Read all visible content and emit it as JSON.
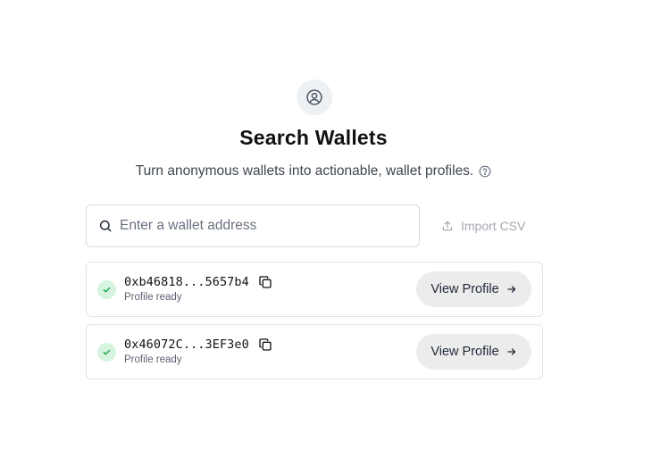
{
  "header": {
    "icon": "user-circle-icon",
    "title": "Search Wallets",
    "subtitle": "Turn anonymous wallets into actionable, wallet profiles.",
    "help_icon": "help-circle-icon"
  },
  "search": {
    "placeholder": "Enter a wallet address",
    "value": "",
    "icon": "search-icon"
  },
  "import": {
    "label": "Import CSV",
    "icon": "upload-icon",
    "enabled": false
  },
  "wallets": [
    {
      "address": "0xb46818...5657b4",
      "status": "Profile ready",
      "action_label": "View Profile"
    },
    {
      "address": "0x46072C...3EF3e0",
      "status": "Profile ready",
      "action_label": "View Profile"
    }
  ],
  "colors": {
    "status_ready_bg": "#d6f5e1",
    "status_ready_fg": "#16a34a",
    "button_bg": "#ececec"
  }
}
